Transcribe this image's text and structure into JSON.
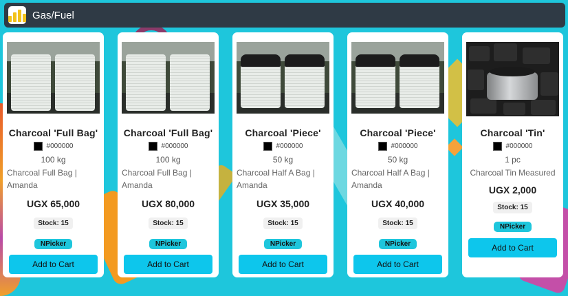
{
  "header": {
    "title": "Gas/Fuel",
    "icon": "fuel-coins-icon"
  },
  "products": [
    {
      "name": "Charcoal 'Full Bag'",
      "color_code": "#000000",
      "quantity": "100 kg",
      "description": "Charcoal Full Bag | Amanda",
      "price": "UGX 65,000",
      "stock": "Stock: 15",
      "tag": "NPicker",
      "button": "Add to Cart",
      "image": "charcoal-full-bag"
    },
    {
      "name": "Charcoal 'Full Bag'",
      "color_code": "#000000",
      "quantity": "100 kg",
      "description": "Charcoal Full Bag | Amanda",
      "price": "UGX 80,000",
      "stock": "Stock: 15",
      "tag": "NPicker",
      "button": "Add to Cart",
      "image": "charcoal-full-bag"
    },
    {
      "name": "Charcoal 'Piece'",
      "color_code": "#000000",
      "quantity": "50 kg",
      "description": "Charcoal Half A Bag | Amanda",
      "price": "UGX 35,000",
      "stock": "Stock: 15",
      "tag": "NPicker",
      "button": "Add to Cart",
      "image": "charcoal-half-bag"
    },
    {
      "name": "Charcoal 'Piece'",
      "color_code": "#000000",
      "quantity": "50 kg",
      "description": "Charcoal Half A Bag | Amanda",
      "price": "UGX 40,000",
      "stock": "Stock: 15",
      "tag": "NPicker",
      "button": "Add to Cart",
      "image": "charcoal-half-bag"
    },
    {
      "name": "Charcoal 'Tin'",
      "color_code": "#000000",
      "quantity": "1 pc",
      "description": "Charcoal Tin Measured",
      "price": "UGX 2,000",
      "stock": "Stock: 15",
      "tag": "NPicker",
      "button": "Add to Cart",
      "image": "charcoal-tin"
    }
  ],
  "colors": {
    "accent": "#0dc6ec",
    "header_bg": "#2f3a45",
    "page_bg": "#1ec6dc"
  }
}
